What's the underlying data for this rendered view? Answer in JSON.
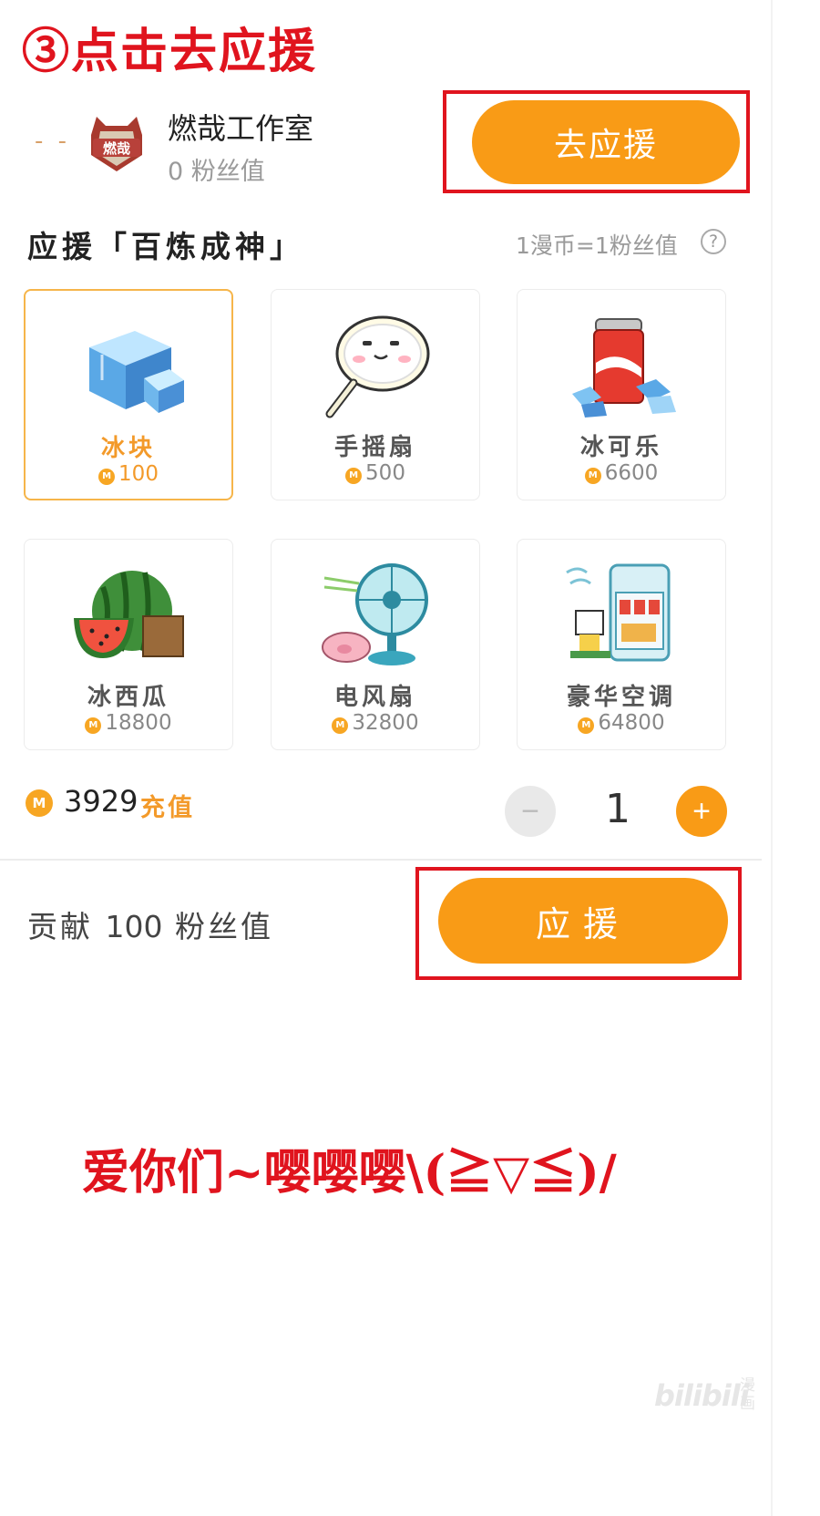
{
  "caption": {
    "step": "③点击去应援"
  },
  "studio": {
    "dashes": "- -",
    "logo_text": "燃哉",
    "name": "燃哉工作室",
    "fans": "0 粉丝值",
    "go_support_label": "去应援"
  },
  "section": {
    "title": "应援「百炼成神」",
    "rate": "1漫币=1粉丝值",
    "help": "?"
  },
  "gifts": [
    {
      "name": "冰块",
      "price": "100",
      "selected": true
    },
    {
      "name": "手摇扇",
      "price": "500"
    },
    {
      "name": "冰可乐",
      "price": "6600"
    },
    {
      "name": "冰西瓜",
      "price": "18800"
    },
    {
      "name": "电风扇",
      "price": "32800"
    },
    {
      "name": "豪华空调",
      "price": "64800"
    }
  ],
  "balance": {
    "coin_symbol": "M",
    "value": "3929",
    "recharge_label": "充值"
  },
  "quantity": {
    "minus": "−",
    "value": "1",
    "plus": "+"
  },
  "contribute": {
    "prefix": "贡献",
    "amount": "100",
    "suffix": "粉丝值"
  },
  "support_label": "应援",
  "love_caption": "爱你们~嘤嘤嘤\\(≧▽≦)/",
  "watermark": {
    "brand": "bilibili",
    "sub": "漫画"
  },
  "colors": {
    "accent": "#f99b16",
    "annotation_red": "#e0141e",
    "selected_border": "#f6b54a"
  },
  "icons": {
    "gift_1": "ice-cube-icon",
    "gift_2": "hand-fan-icon",
    "gift_3": "iced-cola-icon",
    "gift_4": "watermelon-icon",
    "gift_5": "electric-fan-icon",
    "gift_6": "air-conditioner-icon"
  }
}
